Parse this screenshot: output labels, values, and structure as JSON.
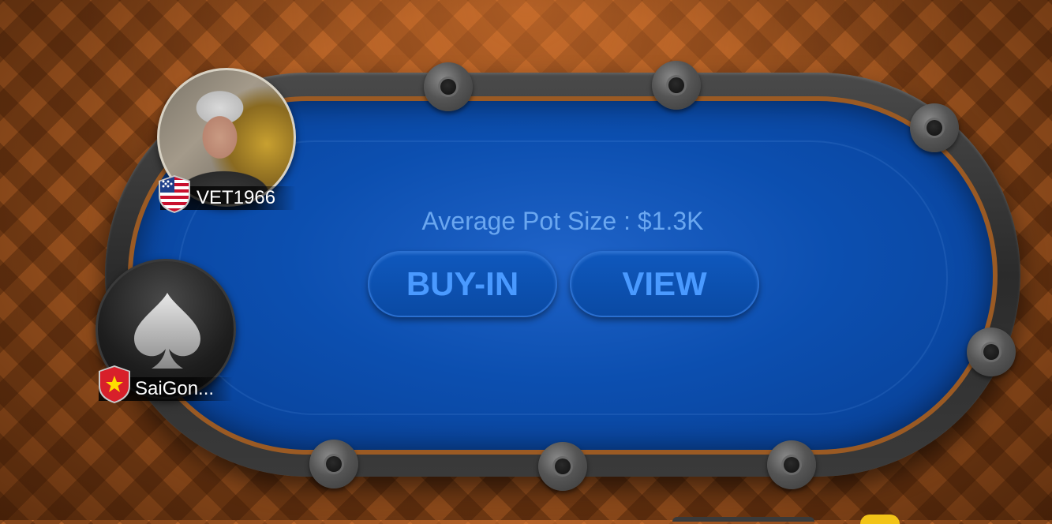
{
  "table": {
    "average_pot_label": "Average Pot Size : $1.3K",
    "felt_color": "#0c4fb0",
    "buttons": {
      "buy_in": "BUY-IN",
      "view": "VIEW"
    }
  },
  "players": [
    {
      "name": "VET1966",
      "country_flag": "us-flag-icon",
      "avatar": "photo-avatar"
    },
    {
      "name": "SaiGon...",
      "country_flag": "vietnam-flag-icon",
      "avatar": "spade-avatar"
    }
  ]
}
